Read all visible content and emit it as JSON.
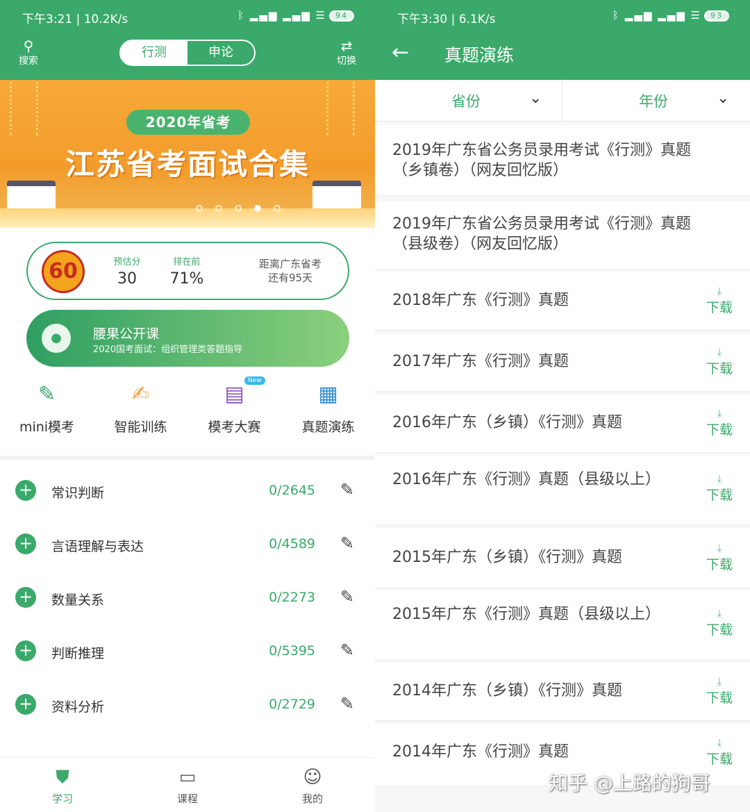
{
  "left": {
    "status": {
      "time": "下午3:21 | 10.2K/s",
      "signal": "ᛒ ▂▄▆ ▂▄▆ ☰",
      "battery": "94"
    },
    "header": {
      "search_label": "搜索",
      "tabs": [
        {
          "label": "行测",
          "active": true
        },
        {
          "label": "申论",
          "active": false
        }
      ],
      "switch_label": "切换"
    },
    "banner": {
      "pill": "2020年省考",
      "headline": "江苏省考面试合集",
      "dots": 5,
      "active_dot": 3
    },
    "score_card": {
      "logo": "60",
      "predicted_label": "预估分",
      "predicted_value": "30",
      "rank_label": "排在前",
      "rank_value": "71%",
      "countdown_line1": "距离广东省考",
      "countdown_line2": "还有95天"
    },
    "course": {
      "title": "腰果公开课",
      "subtitle": "2020国考面试：组织管理类答题指导"
    },
    "quick_menu": [
      {
        "label": "mini模考",
        "icon": "pencil-icon"
      },
      {
        "label": "智能训练",
        "icon": "edit-note-icon"
      },
      {
        "label": "模考大赛",
        "icon": "document-icon",
        "badge": "New"
      },
      {
        "label": "真题演练",
        "icon": "file-stack-icon"
      }
    ],
    "subjects": [
      {
        "name": "常识判断",
        "count": "0/2645"
      },
      {
        "name": "言语理解与表达",
        "count": "0/4589"
      },
      {
        "name": "数量关系",
        "count": "0/2273"
      },
      {
        "name": "判断推理",
        "count": "0/5395"
      },
      {
        "name": "资料分析",
        "count": "0/2729"
      }
    ],
    "bottom_nav": [
      {
        "label": "学习",
        "icon": "study-icon",
        "active": true
      },
      {
        "label": "课程",
        "icon": "course-icon",
        "active": false
      },
      {
        "label": "我的",
        "icon": "user-icon",
        "active": false
      }
    ]
  },
  "right": {
    "status": {
      "time": "下午3:30 | 6.1K/s",
      "signal": "ᛒ ▂▄▆ ▂▄▆ ☰",
      "battery": "93"
    },
    "title": "真题演练",
    "filters": [
      {
        "label": "省份"
      },
      {
        "label": "年份"
      }
    ],
    "download_label": "下载",
    "papers": [
      {
        "title": "2019年广东省公务员录用考试《行测》真题（乡镇卷）（网友回忆版）",
        "download": false
      },
      {
        "title": "2019年广东省公务员录用考试《行测》真题（县级卷）（网友回忆版）",
        "download": false
      },
      {
        "title": "2018年广东《行测》真题",
        "download": true
      },
      {
        "title": "2017年广东《行测》真题",
        "download": true
      },
      {
        "title": "2016年广东（乡镇）《行测》真题",
        "download": true
      },
      {
        "title": "2016年广东《行测》真题（县级以上）",
        "download": true
      },
      {
        "title": "2015年广东（乡镇）《行测》真题",
        "download": true
      },
      {
        "title": "2015年广东《行测》真题（县级以上）",
        "download": true
      },
      {
        "title": "2014年广东（乡镇）《行测》真题",
        "download": true
      },
      {
        "title": "2014年广东《行测》真题",
        "download": true
      }
    ],
    "watermark": "知乎 @上路的狗哥"
  },
  "colors": {
    "primary": "#3aa96a",
    "banner": "#f39c2c"
  }
}
